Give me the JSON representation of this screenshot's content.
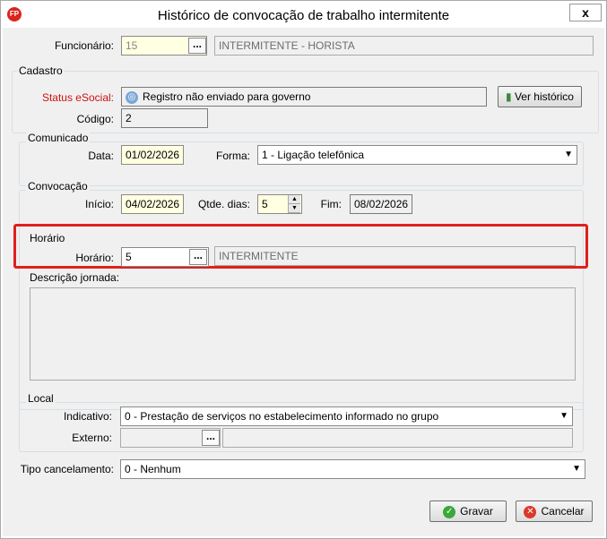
{
  "window": {
    "title": "Histórico de convocação de trabalho intermitente",
    "app_icon_text": "FP",
    "close_glyph": "x"
  },
  "funcionario": {
    "label": "Funcionário:",
    "code": "15",
    "name": "INTERMITENTE - HORISTA",
    "lookup_glyph": "..."
  },
  "cadastro": {
    "title": "Cadastro",
    "status_label": "Status eSocial:",
    "status_value": "Registro não enviado para governo",
    "historico_button": "Ver histórico",
    "codigo_label": "Código:",
    "codigo_value": "2"
  },
  "comunicado": {
    "title": "Comunicado",
    "data_label": "Data:",
    "data_value": "01/02/2026",
    "forma_label": "Forma:",
    "forma_value": "1 - Ligação telefônica"
  },
  "convocacao": {
    "title": "Convocação",
    "inicio_label": "Início:",
    "inicio_value": "04/02/2026",
    "qtde_label": "Qtde. dias:",
    "qtde_value": "5",
    "fim_label": "Fim:",
    "fim_value": "08/02/2026"
  },
  "horario": {
    "title": "Horário",
    "label": "Horário:",
    "code": "5",
    "name": "INTERMITENTE",
    "lookup_glyph": "..."
  },
  "descricao": {
    "label": "Descrição jornada:"
  },
  "local": {
    "title": "Local",
    "indicativo_label": "Indicativo:",
    "indicativo_value": "0 - Prestação de serviços no estabelecimento informado no grupo",
    "externo_label": "Externo:",
    "lookup_glyph": "..."
  },
  "cancelamento": {
    "label": "Tipo cancelamento:",
    "value": "0 - Nenhum"
  },
  "buttons": {
    "gravar": "Gravar",
    "cancelar": "Cancelar"
  },
  "colors": {
    "highlight": "#e0201c",
    "required_field": "#ffffe1",
    "status_label": "#d01010"
  }
}
